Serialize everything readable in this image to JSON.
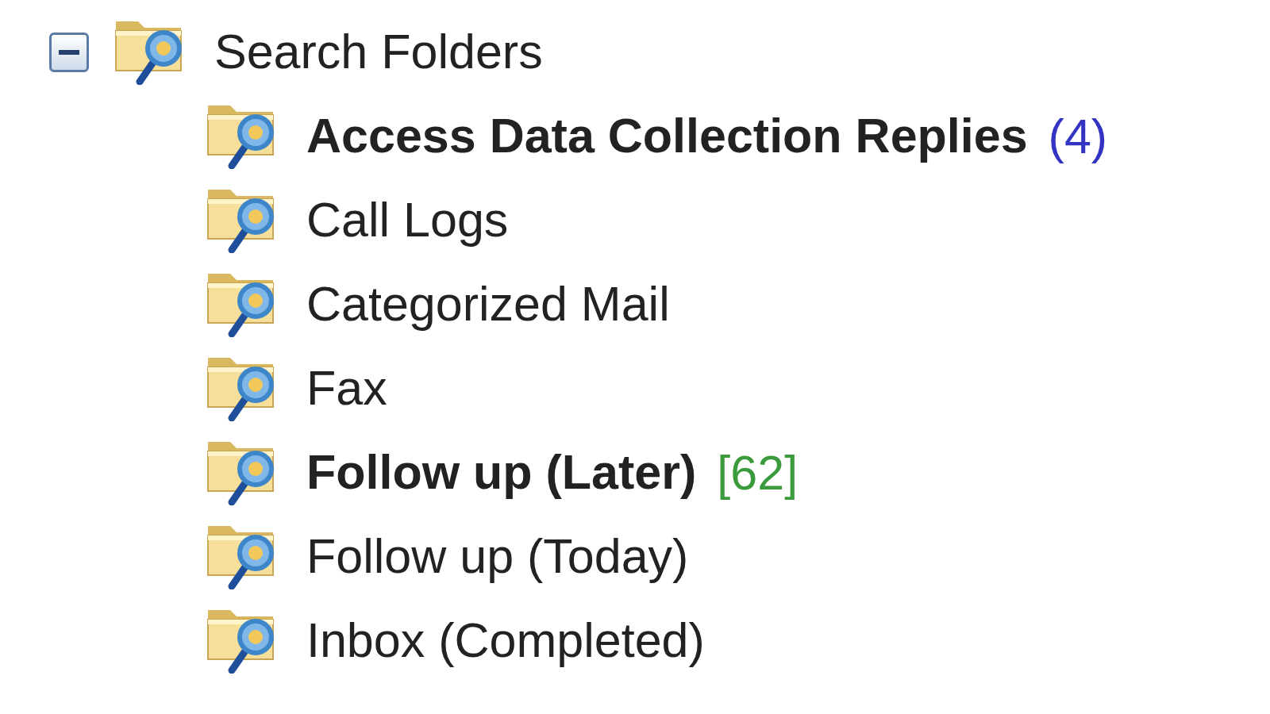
{
  "tree": {
    "label": "Search Folders",
    "expanded": true,
    "children": [
      {
        "label": "Access Data Collection Replies",
        "unread": true,
        "count": "(4)",
        "color": "#3333c4"
      },
      {
        "label": "Call Logs",
        "unread": false
      },
      {
        "label": "Categorized Mail",
        "unread": false
      },
      {
        "label": "Fax",
        "unread": false
      },
      {
        "label": "Follow up (Later)",
        "unread": true,
        "count": "[62]",
        "color": "#3b9a3b"
      },
      {
        "label": "Follow up (Today)",
        "unread": false
      },
      {
        "label": "Inbox (Completed)",
        "unread": false
      }
    ]
  }
}
